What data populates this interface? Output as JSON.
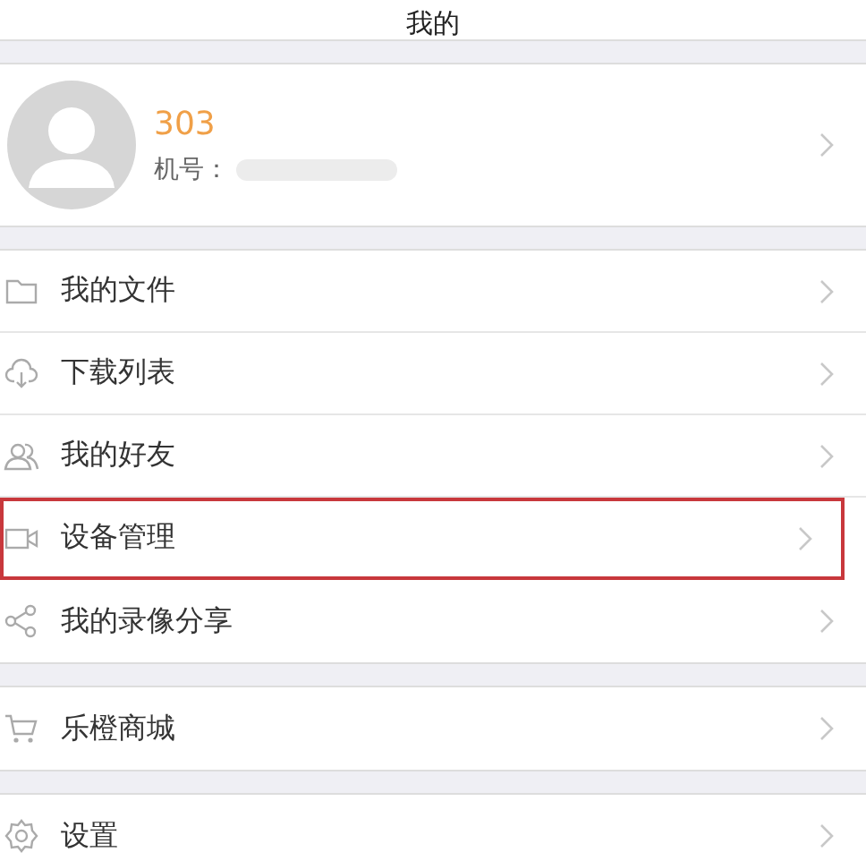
{
  "header": {
    "title": "我的"
  },
  "profile": {
    "name": "303",
    "phone_label": "机号："
  },
  "groups": [
    {
      "items": [
        {
          "kind": "folder",
          "label": "我的文件",
          "selected": false
        },
        {
          "kind": "cloud",
          "label": "下载列表",
          "selected": false
        },
        {
          "kind": "friends",
          "label": "我的好友",
          "selected": false
        },
        {
          "kind": "camera",
          "label": "设备管理",
          "selected": true
        },
        {
          "kind": "share",
          "label": "我的录像分享",
          "selected": false
        }
      ]
    },
    {
      "items": [
        {
          "kind": "cart",
          "label": "乐橙商城",
          "selected": false
        }
      ]
    },
    {
      "items": [
        {
          "kind": "gear",
          "label": "设置",
          "selected": false
        }
      ]
    }
  ]
}
